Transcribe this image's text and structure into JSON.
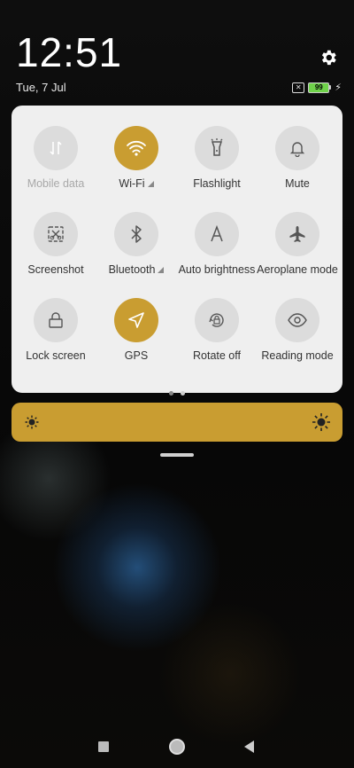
{
  "status": {
    "time": "12:51",
    "date": "Tue, 7 Jul",
    "battery_level": "99",
    "sim_icon": "no-sim-icon",
    "charging_icon": "bolt-icon"
  },
  "colors": {
    "accent": "#c99d31",
    "tile_inactive": "#dcdcdc",
    "panel_bg": "#efefef"
  },
  "quick_settings": {
    "tiles": [
      {
        "label": "Mobile data",
        "icon": "mobile-data-icon",
        "active": false,
        "disabled": true
      },
      {
        "label": "Wi-Fi",
        "icon": "wifi-icon",
        "active": true,
        "expandable": true
      },
      {
        "label": "Flashlight",
        "icon": "flashlight-icon",
        "active": false
      },
      {
        "label": "Mute",
        "icon": "bell-icon",
        "active": false
      },
      {
        "label": "Screenshot",
        "icon": "screenshot-icon",
        "active": false
      },
      {
        "label": "Bluetooth",
        "icon": "bluetooth-icon",
        "active": false,
        "expandable": true
      },
      {
        "label": "Auto brightness",
        "icon": "auto-brightness-icon",
        "active": false
      },
      {
        "label": "Aeroplane mode",
        "icon": "airplane-icon",
        "active": false
      },
      {
        "label": "Lock screen",
        "icon": "lock-icon",
        "active": false
      },
      {
        "label": "GPS",
        "icon": "location-icon",
        "active": true
      },
      {
        "label": "Rotate off",
        "icon": "rotate-lock-icon",
        "active": false
      },
      {
        "label": "Reading mode",
        "icon": "eye-icon",
        "active": false
      }
    ],
    "page_count": 2,
    "current_page": 1
  },
  "brightness": {
    "level_fraction": 1.0
  }
}
